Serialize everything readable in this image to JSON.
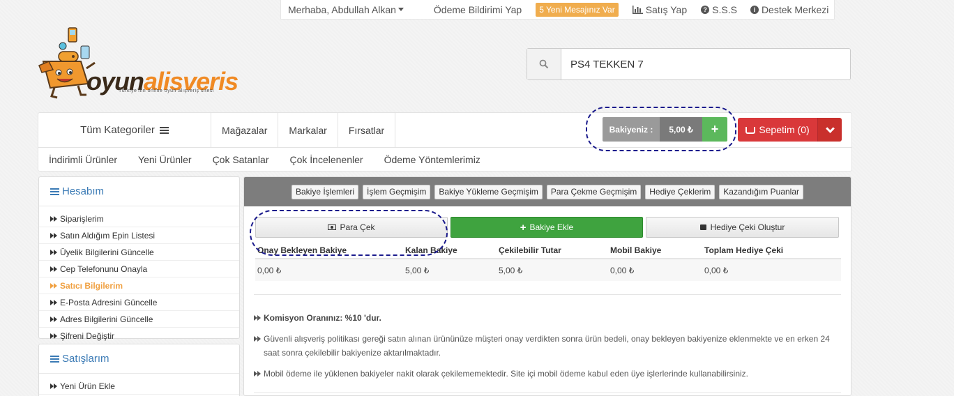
{
  "topbar": {
    "greeting": "Merhaba, Abdullah Alkan",
    "payment_notice": "Ödeme Bildirimi Yap",
    "messages_badge": "5 Yeni Mesajınız Var",
    "sell": "Satış Yap",
    "faq": "S.S.S",
    "support": "Destek Merkezi"
  },
  "logo": {
    "part1": "oyun",
    "part2": "alisveris",
    "tagline": "Türkiye'nin online oyun alışveriş sitesi"
  },
  "search": {
    "value": "PS4 TEKKEN 7"
  },
  "nav": {
    "all_categories": "Tüm Kategoriler",
    "links": [
      "Mağazalar",
      "Markalar",
      "Fırsatlar"
    ],
    "sub_links": [
      "İndirimli Ürünler",
      "Yeni Ürünler",
      "Çok Satanlar",
      "Çok İncelenenler",
      "Ödeme Yöntemlerimiz"
    ]
  },
  "balance": {
    "label": "Bakiyeniz :",
    "value": "5,00 ₺",
    "add": "+"
  },
  "cart": {
    "label": "Sepetim (0)"
  },
  "sidebar": {
    "account_title": "Hesabım",
    "account_items": [
      "Siparişlerim",
      "Satın Aldığım Epin Listesi",
      "Üyelik Bilgilerini Güncelle",
      "Cep Telefonunu Onayla",
      "Satıcı Bilgilerim",
      "E-Posta Adresini Güncelle",
      "Adres Bilgilerini Güncelle",
      "Şifreni Değiştir"
    ],
    "sales_title": "Satışlarım",
    "sales_items": [
      "Yeni Ürün Ekle"
    ]
  },
  "main": {
    "tabs": [
      "Bakiye İşlemleri",
      "İşlem Geçmişim",
      "Bakiye Yükleme Geçmişim",
      "Para Çekme Geçmişim",
      "Hediye Çeklerim",
      "Kazandığım Puanlar"
    ],
    "withdraw": "Para Çek",
    "add_balance": "Bakiye Ekle",
    "gift_card": "Hediye Çeki Oluştur",
    "table": {
      "headers": [
        "Onay Bekleyen Bakiye",
        "Kalan Bakiye",
        "Çekilebilir Tutar",
        "Mobil Bakiye",
        "Toplam Hediye Çeki"
      ],
      "values": [
        "0,00 ₺",
        "5,00 ₺",
        "5,00 ₺",
        "0,00 ₺",
        "0,00 ₺"
      ]
    },
    "notes": [
      "Komisyon Oranınız: %10 'dur.",
      "Güvenli alışveriş politikası gereği satın alınan ürününüze müşteri onay verdikten sonra ürün bedeli, onay bekleyen bakiyenize eklenmekte ve en erken 24 saat sonra çekilebilir bakiyenize aktarılmaktadır.",
      "Mobil ödeme ile yüklenen bakiyeler nakit olarak çekilememektedir. Site içi mobil ödeme kabul eden üye işlerlerinde kullanabilirsiniz."
    ]
  }
}
